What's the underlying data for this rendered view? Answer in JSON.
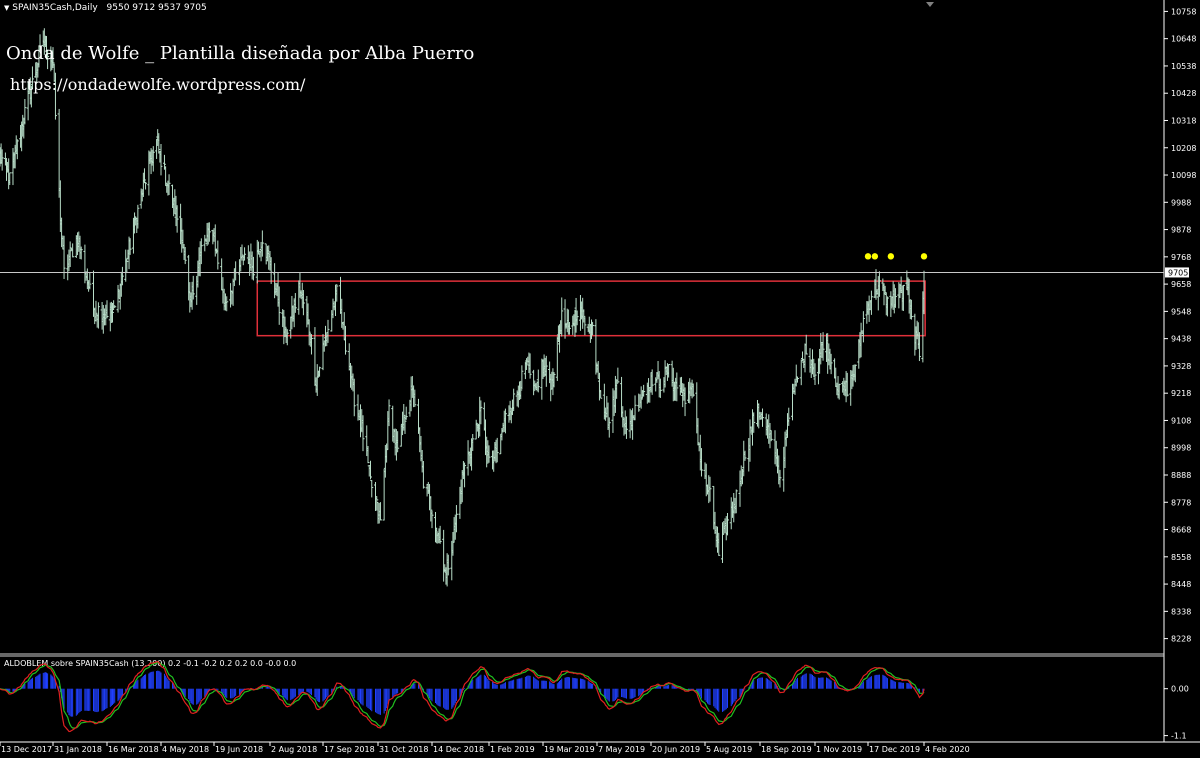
{
  "header": {
    "dropdown_icon": "triangle-down-icon",
    "symbol_info": "SPAIN35Cash,Daily",
    "ohlc": "9550 9712 9537 9705"
  },
  "watermark": {
    "title": "Onda de Wolfe _ Plantilla diseñada por Alba Puerro",
    "url": "https://ondadewolfe.wordpress.com/"
  },
  "colors": {
    "background": "#000000",
    "axis": "#ffffff",
    "candle": "#b8ddc8",
    "zone_box": "#e0303a",
    "dots": "#ffff00",
    "osc_main": "#e02020",
    "osc_signal": "#20c020",
    "osc_hist": "#2040ff"
  },
  "chart_data": [
    {
      "type": "candlestick",
      "title": "SPAIN35Cash,Daily",
      "ylim": [
        8174,
        10804
      ],
      "y_ticks": [
        "10758",
        "10648",
        "10538",
        "10428",
        "10318",
        "10208",
        "10098",
        "9988",
        "9878",
        "9768",
        "9658",
        "9548",
        "9438",
        "9328",
        "9218",
        "9108",
        "8998",
        "8888",
        "8778",
        "8668",
        "8558",
        "8448",
        "8338",
        "8228"
      ],
      "current_price": "9705",
      "x_ticks": [
        "13 Dec 2017",
        "31 Jan 2018",
        "16 Mar 2018",
        "4 May 2018",
        "19 Jun 2018",
        "2 Aug 2018",
        "17 Sep 2018",
        "31 Oct 2018",
        "14 Dec 2018",
        "1 Feb 2019",
        "19 Mar 2019",
        "7 May 2019",
        "20 Jun 2019",
        "5 Aug 2019",
        "18 Sep 2019",
        "1 Nov 2019",
        "17 Dec 2019",
        "4 Feb 2020"
      ],
      "anchors": [
        [
          "2017-12-13",
          10180
        ],
        [
          "2017-12-22",
          10080
        ],
        [
          "2018-01-05",
          10350
        ],
        [
          "2018-01-22",
          10640
        ],
        [
          "2018-01-31",
          10550
        ],
        [
          "2018-02-06",
          9920
        ],
        [
          "2018-02-09",
          9700
        ],
        [
          "2018-02-20",
          9850
        ],
        [
          "2018-03-05",
          9560
        ],
        [
          "2018-03-22",
          9540
        ],
        [
          "2018-04-06",
          9820
        ],
        [
          "2018-04-18",
          10050
        ],
        [
          "2018-04-30",
          10230
        ],
        [
          "2018-05-10",
          10060
        ],
        [
          "2018-05-22",
          9860
        ],
        [
          "2018-05-29",
          9560
        ],
        [
          "2018-06-08",
          9800
        ],
        [
          "2018-06-18",
          9880
        ],
        [
          "2018-06-27",
          9580
        ],
        [
          "2018-07-06",
          9690
        ],
        [
          "2018-07-13",
          9780
        ],
        [
          "2018-07-20",
          9730
        ],
        [
          "2018-07-27",
          9850
        ],
        [
          "2018-08-08",
          9620
        ],
        [
          "2018-08-15",
          9450
        ],
        [
          "2018-08-23",
          9560
        ],
        [
          "2018-08-28",
          9640
        ],
        [
          "2018-09-06",
          9460
        ],
        [
          "2018-09-11",
          9260
        ],
        [
          "2018-09-17",
          9400
        ],
        [
          "2018-09-28",
          9620
        ],
        [
          "2018-10-05",
          9420
        ],
        [
          "2018-10-11",
          9220
        ],
        [
          "2018-10-18",
          9080
        ],
        [
          "2018-10-25",
          8860
        ],
        [
          "2018-11-02",
          8700
        ],
        [
          "2018-11-09",
          9150
        ],
        [
          "2018-11-16",
          8980
        ],
        [
          "2018-11-23",
          9150
        ],
        [
          "2018-11-29",
          9230
        ],
        [
          "2018-12-07",
          8860
        ],
        [
          "2018-12-14",
          8750
        ],
        [
          "2018-12-21",
          8620
        ],
        [
          "2018-12-26",
          8480
        ],
        [
          "2019-01-02",
          8660
        ],
        [
          "2019-01-10",
          8900
        ],
        [
          "2019-01-18",
          9030
        ],
        [
          "2019-01-25",
          9140
        ],
        [
          "2019-02-01",
          8930
        ],
        [
          "2019-02-08",
          8980
        ],
        [
          "2019-02-15",
          9120
        ],
        [
          "2019-02-26",
          9230
        ],
        [
          "2019-03-05",
          9330
        ],
        [
          "2019-03-12",
          9210
        ],
        [
          "2019-03-18",
          9330
        ],
        [
          "2019-03-27",
          9260
        ],
        [
          "2019-04-05",
          9520
        ],
        [
          "2019-04-12",
          9460
        ],
        [
          "2019-04-19",
          9560
        ],
        [
          "2019-04-26",
          9510
        ],
        [
          "2019-05-03",
          9480
        ],
        [
          "2019-05-10",
          9220
        ],
        [
          "2019-05-17",
          9100
        ],
        [
          "2019-05-24",
          9270
        ],
        [
          "2019-05-31",
          9050
        ],
        [
          "2019-06-07",
          9150
        ],
        [
          "2019-06-14",
          9230
        ],
        [
          "2019-06-21",
          9280
        ],
        [
          "2019-06-28",
          9260
        ],
        [
          "2019-07-04",
          9310
        ],
        [
          "2019-07-12",
          9240
        ],
        [
          "2019-07-19",
          9210
        ],
        [
          "2019-07-26",
          9220
        ],
        [
          "2019-08-02",
          8910
        ],
        [
          "2019-08-09",
          8800
        ],
        [
          "2019-08-16",
          8560
        ],
        [
          "2019-08-23",
          8700
        ],
        [
          "2019-08-30",
          8800
        ],
        [
          "2019-09-06",
          8980
        ],
        [
          "2019-09-13",
          9120
        ],
        [
          "2019-09-20",
          9140
        ],
        [
          "2019-09-27",
          9020
        ],
        [
          "2019-10-04",
          8860
        ],
        [
          "2019-10-11",
          9150
        ],
        [
          "2019-10-18",
          9280
        ],
        [
          "2019-10-25",
          9400
        ],
        [
          "2019-11-01",
          9300
        ],
        [
          "2019-11-08",
          9430
        ],
        [
          "2019-11-15",
          9350
        ],
        [
          "2019-11-22",
          9220
        ],
        [
          "2019-11-29",
          9240
        ],
        [
          "2019-12-06",
          9310
        ],
        [
          "2019-12-13",
          9510
        ],
        [
          "2019-12-20",
          9620
        ],
        [
          "2019-12-27",
          9650
        ],
        [
          "2020-01-03",
          9580
        ],
        [
          "2020-01-09",
          9600
        ],
        [
          "2020-01-16",
          9620
        ],
        [
          "2020-01-20",
          9650
        ],
        [
          "2020-01-24",
          9510
        ],
        [
          "2020-01-31",
          9380
        ],
        [
          "2020-02-04",
          9705
        ]
      ],
      "resistance_zone": {
        "x0": "2018-07-23",
        "x1": "2020-02-05",
        "y_top": 9670,
        "y_bottom": 9450
      },
      "top_markers": [
        "2019-12-17",
        "2019-12-23",
        "2020-01-06",
        "2020-02-04"
      ],
      "marker_price": 9770
    },
    {
      "type": "oscillator",
      "title": "ALDOBLEM sobre SPAIN35Cash (13,200) 0.2 -0.1 -0.2 0.2 0.2 0.0 -0.0 0.0",
      "y_ticks": [
        "0.00",
        "-1.1"
      ],
      "ylim": [
        -1.25,
        0.72
      ],
      "series": [
        "main",
        "signal",
        "histogram"
      ]
    }
  ]
}
